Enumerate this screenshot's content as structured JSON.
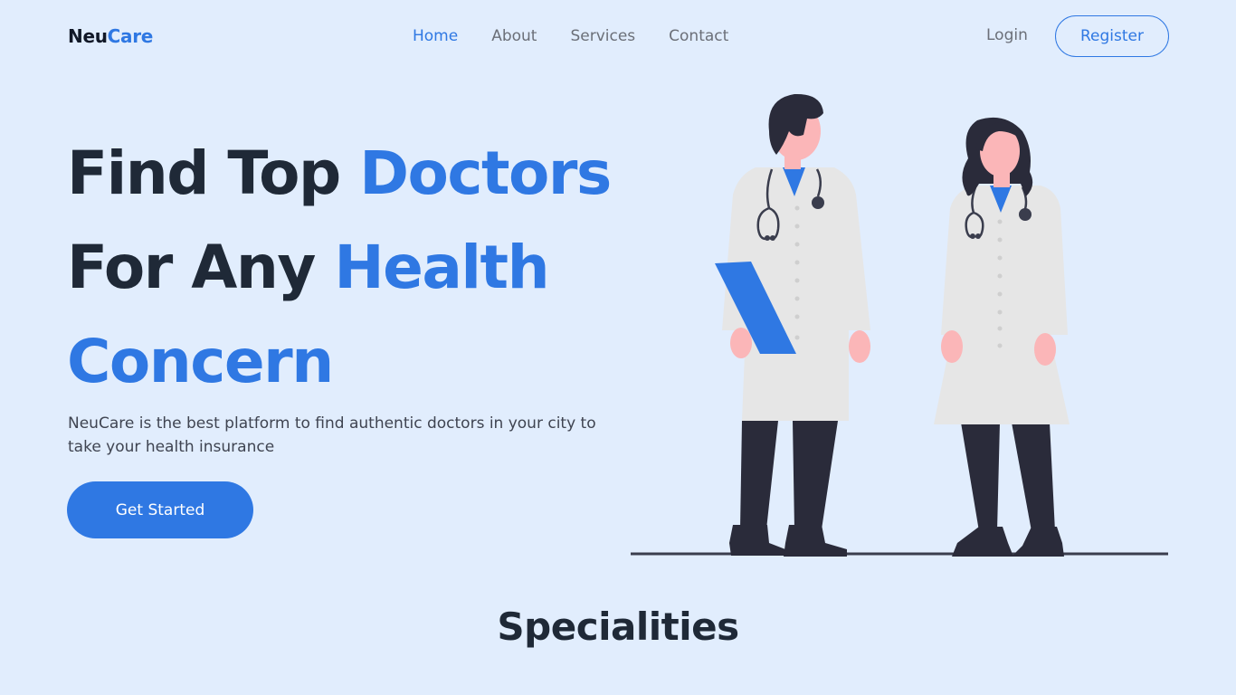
{
  "brand": {
    "part1": "Neu",
    "part2": "Care"
  },
  "nav": {
    "items": [
      {
        "label": "Home",
        "active": true
      },
      {
        "label": "About",
        "active": false
      },
      {
        "label": "Services",
        "active": false
      },
      {
        "label": "Contact",
        "active": false
      }
    ],
    "login_label": "Login",
    "register_label": "Register"
  },
  "hero": {
    "line1_plain": "Find Top ",
    "line1_highlight": "Doctors",
    "line2_plain": "For Any ",
    "line2_highlight": "Health",
    "line3_highlight": "Concern",
    "description": "NeuCare is the best platform to find authentic doctors in your city to take your health insurance",
    "cta_label": "Get Started"
  },
  "illustration": {
    "subject": "two-doctors-illustration"
  },
  "section": {
    "title": "Specialities"
  },
  "colors": {
    "background": "#e1edfd",
    "accent": "#2f78e3",
    "heading": "#1f2937",
    "nav_text": "#6b6f78"
  }
}
